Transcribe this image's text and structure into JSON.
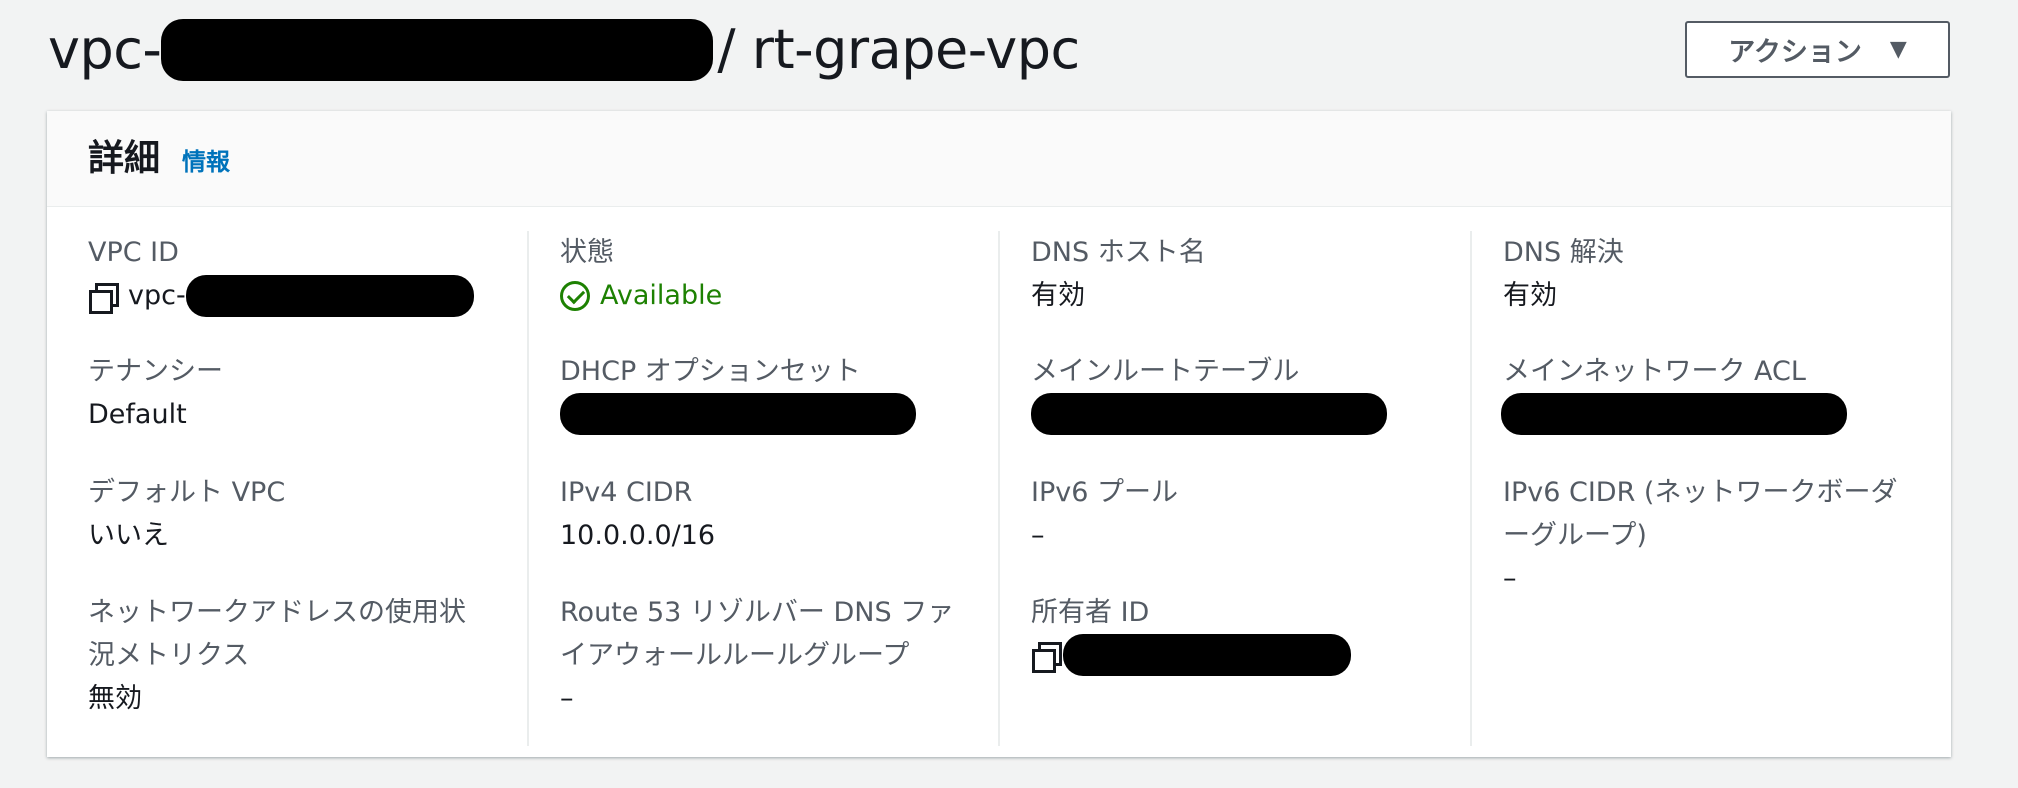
{
  "header": {
    "title_prefix": "vpc-",
    "title_suffix": "/ rt-grape-vpc",
    "actions_label": "アクション",
    "caret": "▼"
  },
  "details": {
    "title": "詳細",
    "info_link": "情報",
    "columns": [
      {
        "fields": [
          {
            "label": "VPC ID",
            "value_prefix": "vpc-",
            "value_redacted": true,
            "icon": "copy-icon"
          },
          {
            "label": "テナンシー",
            "value": "Default"
          },
          {
            "label": "デフォルト VPC",
            "value": "いいえ"
          },
          {
            "label_lines": [
              "ネットワークアドレスの使用状",
              "況メトリクス"
            ],
            "value": "無効"
          }
        ]
      },
      {
        "fields": [
          {
            "label": "状態",
            "value": "Available",
            "icon": "check-circle-icon",
            "status_color": "#1d8102"
          },
          {
            "label": "DHCP オプションセット",
            "value_redacted": true
          },
          {
            "label": "IPv4 CIDR",
            "value": "10.0.0.0/16"
          },
          {
            "label_lines": [
              "Route 53 リゾルバー DNS ファ",
              "イアウォールルールグループ"
            ],
            "value": "–"
          }
        ]
      },
      {
        "fields": [
          {
            "label": "DNS ホスト名",
            "value": "有効"
          },
          {
            "label": "メインルートテーブル",
            "value_redacted": true
          },
          {
            "label": "IPv6 プール",
            "value": "–"
          },
          {
            "label": "所有者 ID",
            "value_redacted": true,
            "icon": "copy-icon"
          }
        ]
      },
      {
        "fields": [
          {
            "label": "DNS 解決",
            "value": "有効"
          },
          {
            "label": "メインネットワーク ACL",
            "value_redacted": true
          },
          {
            "label_lines": [
              "IPv6 CIDR (ネットワークボーダ",
              "ーグループ)"
            ],
            "value": "–"
          }
        ]
      }
    ]
  },
  "colors": {
    "background": "#f2f3f3",
    "link": "#0073bb",
    "success": "#1d8102",
    "label": "#545b64"
  }
}
